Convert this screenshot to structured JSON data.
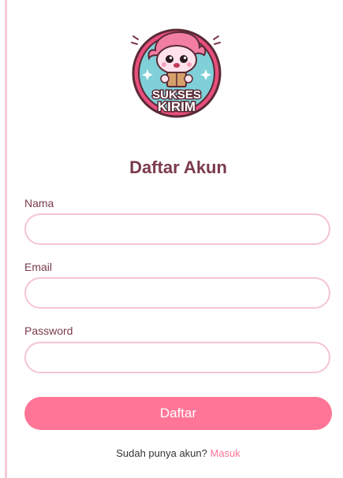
{
  "logo": {
    "line1": "SUKSES",
    "line2": "KIRIM"
  },
  "title": "Daftar Akun",
  "fields": [
    {
      "label": "Nama",
      "value": "",
      "placeholder": ""
    },
    {
      "label": "Email",
      "value": "",
      "placeholder": ""
    },
    {
      "label": "Password",
      "value": "",
      "placeholder": ""
    }
  ],
  "submit_label": "Daftar",
  "footer": {
    "text": "Sudah punya akun?",
    "link": "Masuk"
  },
  "colors": {
    "accent": "#ff7597",
    "text": "#7a3b4b",
    "border": "#f5c4d4"
  }
}
